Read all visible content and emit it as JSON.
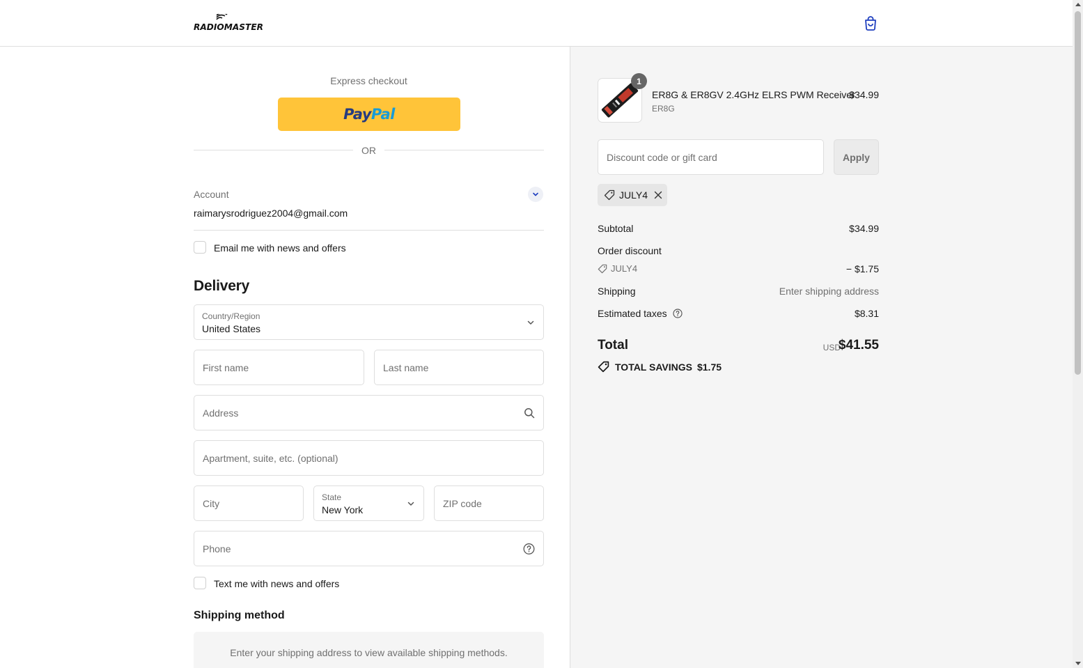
{
  "header": {
    "logo_text": "RADIOMASTER",
    "cart_icon": "shopping-bag-icon"
  },
  "express": {
    "label": "Express checkout",
    "paypal_part1": "Pay",
    "paypal_part2": "Pal",
    "or_text": "OR"
  },
  "account": {
    "label": "Account",
    "email": "raimarysrodriguez2004@gmail.com",
    "email_offers_label": "Email me with news and offers"
  },
  "delivery": {
    "heading": "Delivery",
    "country_label": "Country/Region",
    "country_value": "United States",
    "first_name_placeholder": "First name",
    "last_name_placeholder": "Last name",
    "address_placeholder": "Address",
    "apartment_placeholder": "Apartment, suite, etc. (optional)",
    "city_placeholder": "City",
    "state_label": "State",
    "state_value": "New York",
    "zip_placeholder": "ZIP code",
    "phone_placeholder": "Phone",
    "text_offers_label": "Text me with news and offers"
  },
  "shipping_method": {
    "heading": "Shipping method",
    "message": "Enter your shipping address to view available shipping methods."
  },
  "order": {
    "quantity": "1",
    "product_name": "ER8G & ER8GV 2.4GHz ELRS PWM Receiver",
    "product_variant": "ER8G",
    "product_price": "$34.99",
    "discount_placeholder": "Discount code or gift card",
    "apply_label": "Apply",
    "applied_code": "JULY4",
    "subtotal_label": "Subtotal",
    "subtotal_value": "$34.99",
    "order_discount_label": "Order discount",
    "discount_code": "JULY4",
    "discount_value": "− $1.75",
    "shipping_label": "Shipping",
    "shipping_value": "Enter shipping address",
    "taxes_label": "Estimated taxes",
    "taxes_value": "$8.31",
    "total_label": "Total",
    "total_currency": "USD",
    "total_value": "$41.55",
    "savings_label": "TOTAL SAVINGS",
    "savings_value": "$1.75"
  },
  "colors": {
    "paypal_yellow": "#ffc439",
    "paypal_dark_blue": "#253b80",
    "paypal_light_blue": "#179bd7",
    "cart_blue": "#1f3fbf",
    "summary_bg": "#f5f5f5"
  }
}
